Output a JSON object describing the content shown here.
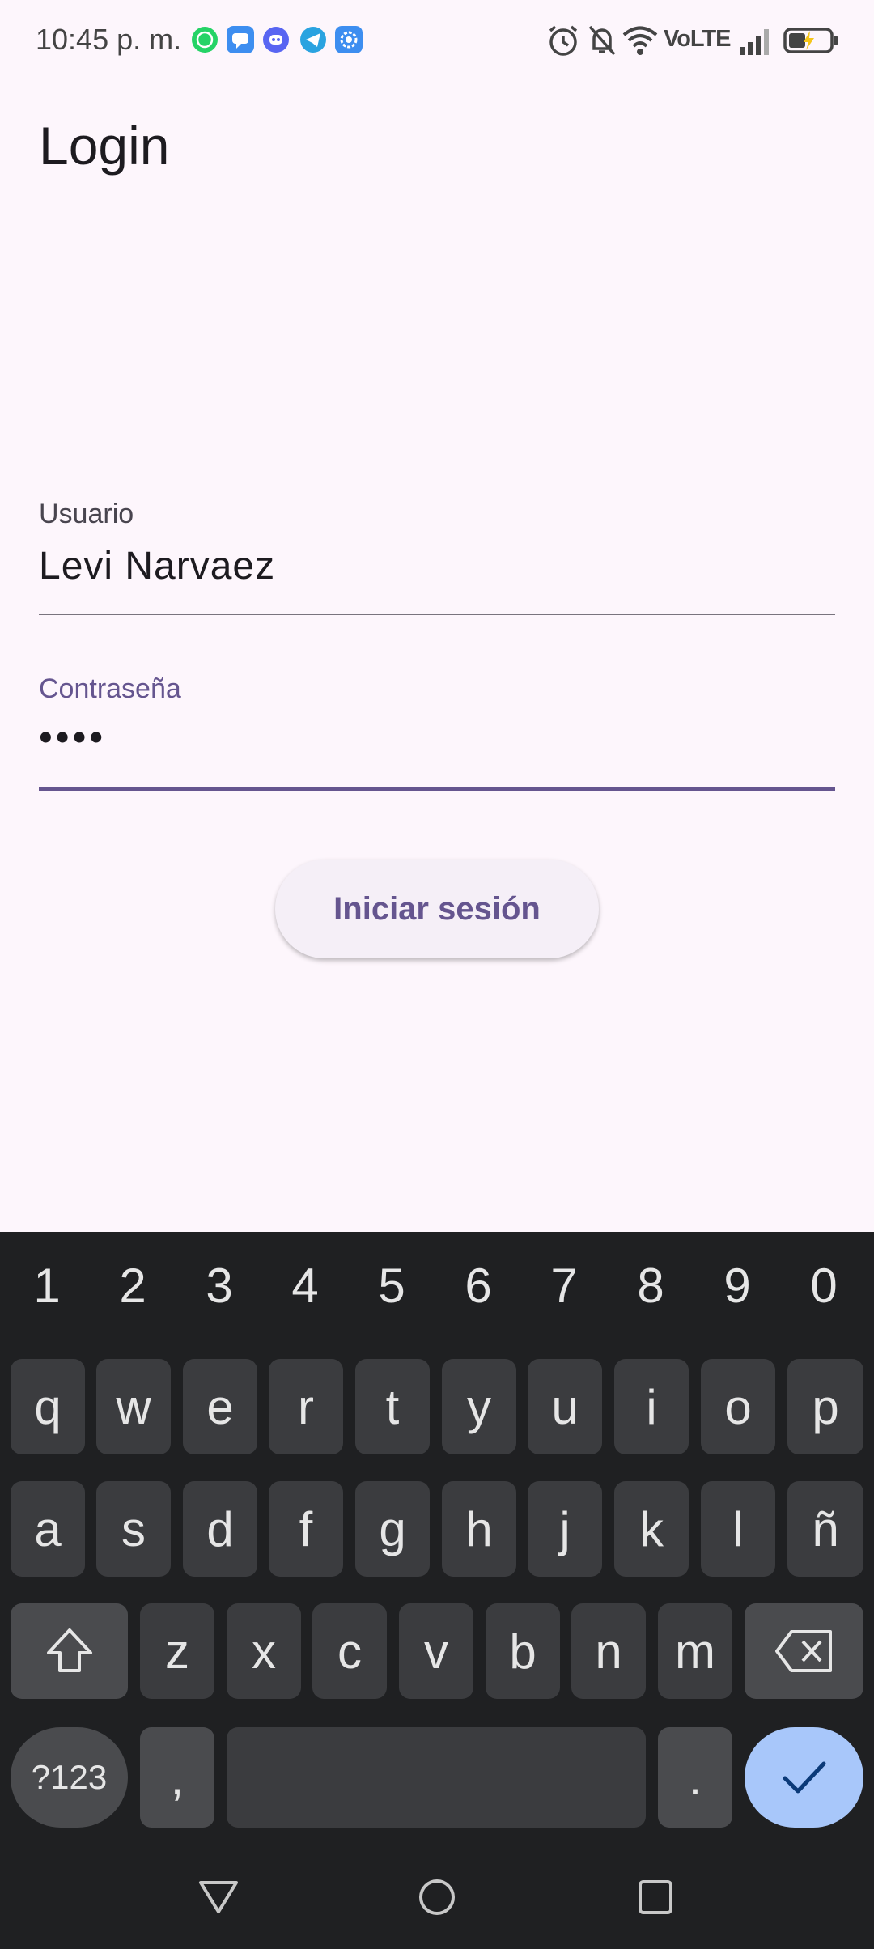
{
  "status_bar": {
    "time": "10:45 p. m.",
    "network_label": "VoLTE",
    "notification_icons": [
      "whatsapp-icon",
      "messages-icon",
      "discord-icon",
      "telegram-icon",
      "settings-app-icon"
    ],
    "status_icons": [
      "alarm-icon",
      "bell-off-icon",
      "wifi-icon",
      "signal-icon",
      "battery-charging-icon"
    ]
  },
  "app": {
    "title": "Login"
  },
  "form": {
    "username_label": "Usuario",
    "username_value": "Levi Narvaez",
    "password_label": "Contraseña",
    "password_value": "••••",
    "submit_label": "Iniciar sesión"
  },
  "keyboard": {
    "number_row": [
      "1",
      "2",
      "3",
      "4",
      "5",
      "6",
      "7",
      "8",
      "9",
      "0"
    ],
    "row1": [
      "q",
      "w",
      "e",
      "r",
      "t",
      "y",
      "u",
      "i",
      "o",
      "p"
    ],
    "row2": [
      "a",
      "s",
      "d",
      "f",
      "g",
      "h",
      "j",
      "k",
      "l",
      "ñ"
    ],
    "row3": [
      "z",
      "x",
      "c",
      "v",
      "b",
      "n",
      "m"
    ],
    "symbols_label": "?123",
    "comma_label": ",",
    "period_label": "."
  },
  "colors": {
    "background": "#fdf6fc",
    "accent": "#65558f",
    "keyboard_bg": "#1f2022",
    "key_bg": "#3b3c3f",
    "enter_key": "#a8c7fa"
  }
}
